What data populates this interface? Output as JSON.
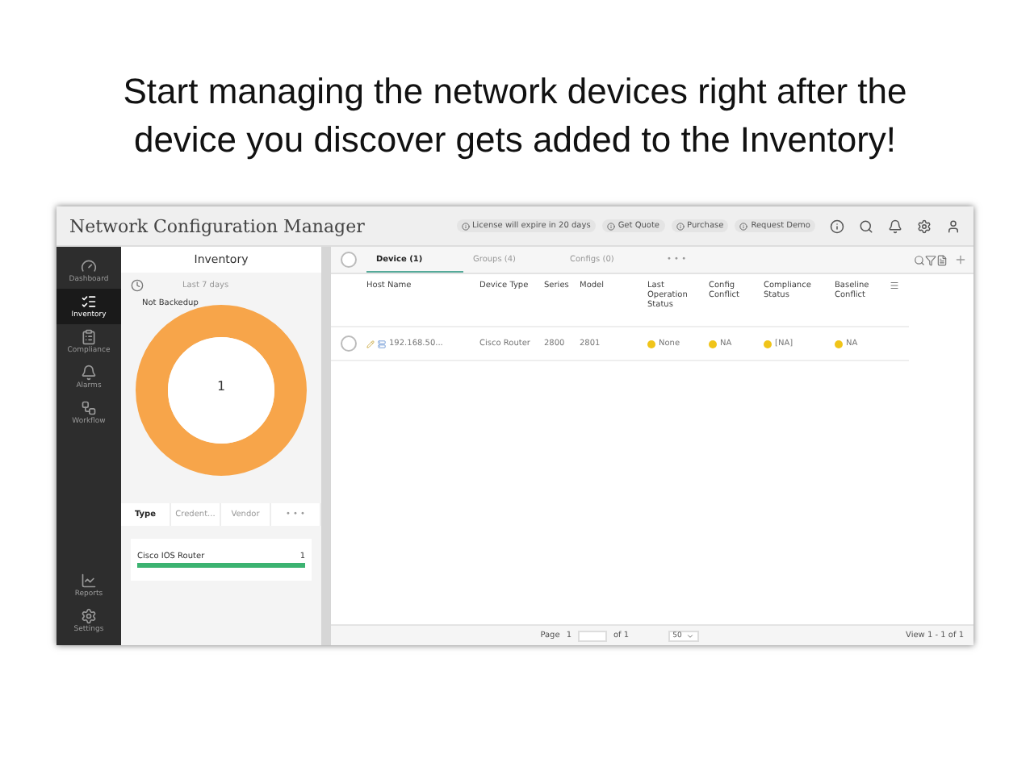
{
  "heading": "Start managing the network devices right after the device you discover gets added to the Inventory!",
  "window": {
    "title": "Network Configuration Manager",
    "notices": [
      "License will expire in 20 days",
      "Get Quote",
      "Purchase",
      "Request Demo"
    ]
  },
  "sidebar": {
    "items": [
      {
        "label": "Dashboard",
        "kind": "gauge",
        "selected": false
      },
      {
        "label": "Inventory",
        "kind": "list",
        "selected": true
      },
      {
        "label": "Compliance",
        "kind": "clipboard",
        "selected": false
      },
      {
        "label": "Alarms",
        "kind": "bell",
        "selected": false
      },
      {
        "label": "Workflow",
        "kind": "flow",
        "selected": false
      },
      {
        "label": "Reports",
        "kind": "chart",
        "selected": false
      },
      {
        "label": "Settings",
        "kind": "gears",
        "selected": false
      }
    ]
  },
  "inventory_panel": {
    "title": "Inventory",
    "period": "Last 7 days",
    "donut_label": "Not Backedup",
    "donut_value": "1",
    "tabs": [
      {
        "label": "Type",
        "selected": true
      },
      {
        "label": "Credent...",
        "selected": false
      },
      {
        "label": "Vendor",
        "selected": false
      },
      {
        "label": "• • •",
        "selected": false
      }
    ],
    "types": [
      {
        "name": "Cisco IOS Router",
        "count": "1",
        "level": 1
      }
    ]
  },
  "main": {
    "select_all": {
      "checked": false
    },
    "tabs": [
      {
        "label": "Device (1)",
        "selected": true
      },
      {
        "label": "Groups (4)",
        "selected": false
      },
      {
        "label": "Configs (0)",
        "selected": false
      },
      {
        "label": "• • •",
        "selected": false
      }
    ],
    "table": {
      "columns": [
        "Host Name",
        "Device Type",
        "Series",
        "Model",
        "Last Operation Status",
        "Config Conflict",
        "Compliance Status",
        "Baseline Conflict"
      ],
      "rows": [
        {
          "selected": false,
          "cells": [
            "192.168.50...",
            "Cisco Router",
            "2800",
            "2801",
            "None",
            "NA",
            "[NA]",
            "NA"
          ]
        }
      ]
    },
    "pager": {
      "page_label": "Page",
      "page": "1",
      "of": "of 1",
      "per_page": "50",
      "summary": "View 1 - 1 of 1"
    }
  }
}
